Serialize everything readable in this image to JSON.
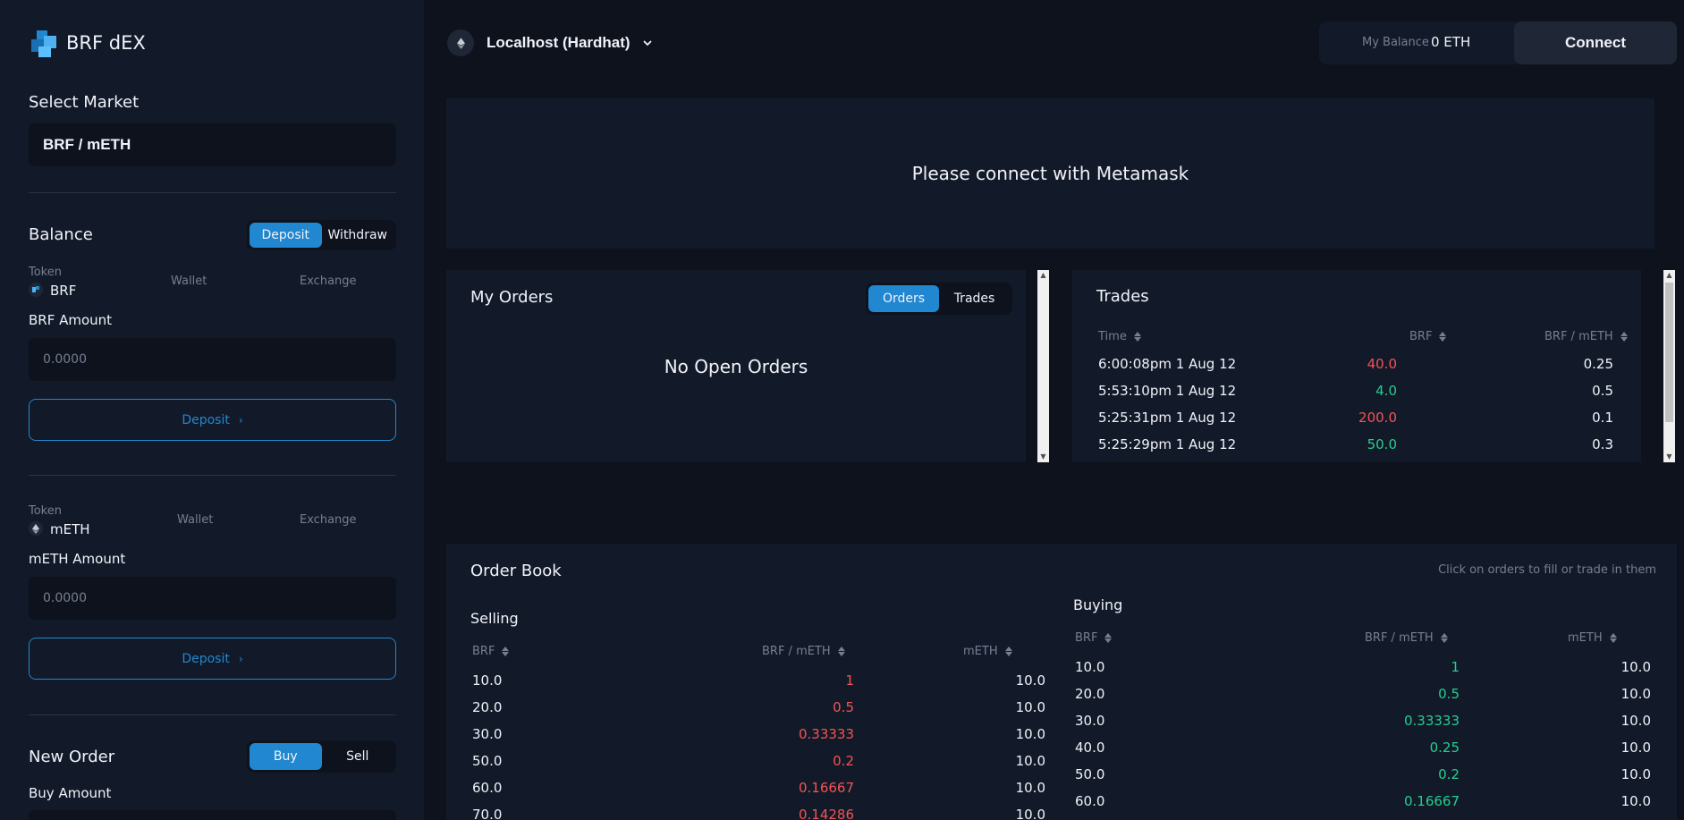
{
  "app": {
    "name": "BRF dEX"
  },
  "sidebar": {
    "select_market_label": "Select Market",
    "market_value": "BRF / mETH",
    "balance": {
      "title": "Balance",
      "tabs": [
        "Deposit",
        "Withdraw"
      ],
      "active_tab": "Deposit",
      "token1": {
        "token_label": "Token",
        "symbol": "BRF",
        "wallet_label": "Wallet",
        "exchange_label": "Exchange",
        "amount_label": "BRF Amount",
        "amount_placeholder": "0.0000",
        "button_label": "Deposit"
      },
      "token2": {
        "token_label": "Token",
        "symbol": "mETH",
        "wallet_label": "Wallet",
        "exchange_label": "Exchange",
        "amount_label": "mETH Amount",
        "amount_placeholder": "0.0000",
        "button_label": "Deposit"
      }
    },
    "new_order": {
      "title": "New Order",
      "tabs": [
        "Buy",
        "Sell"
      ],
      "active_tab": "Buy",
      "amount_label": "Buy Amount"
    }
  },
  "header": {
    "network": "Localhost (Hardhat)",
    "balance_label": "My Balance",
    "balance_value": "0 ETH",
    "connect_label": "Connect"
  },
  "banner": {
    "message": "Please connect with Metamask"
  },
  "my_orders": {
    "title": "My Orders",
    "tabs": [
      "Orders",
      "Trades"
    ],
    "active_tab": "Orders",
    "empty_message": "No Open Orders"
  },
  "trades": {
    "title": "Trades",
    "columns": [
      "Time",
      "BRF",
      "BRF / mETH"
    ],
    "rows": [
      {
        "time": "6:00:08pm 1 Aug 12",
        "amount": "40.0",
        "price": "0.25",
        "side": "sell"
      },
      {
        "time": "5:53:10pm 1 Aug 12",
        "amount": "4.0",
        "price": "0.5",
        "side": "buy"
      },
      {
        "time": "5:25:31pm 1 Aug 12",
        "amount": "200.0",
        "price": "0.1",
        "side": "sell"
      },
      {
        "time": "5:25:29pm 1 Aug 12",
        "amount": "50.0",
        "price": "0.3",
        "side": "buy"
      }
    ]
  },
  "order_book": {
    "title": "Order Book",
    "hint": "Click on orders to fill or trade in them",
    "selling": {
      "title": "Selling",
      "columns": [
        "BRF",
        "BRF / mETH",
        "mETH"
      ],
      "rows": [
        {
          "brf": "10.0",
          "price": "1",
          "meth": "10.0"
        },
        {
          "brf": "20.0",
          "price": "0.5",
          "meth": "10.0"
        },
        {
          "brf": "30.0",
          "price": "0.33333",
          "meth": "10.0"
        },
        {
          "brf": "50.0",
          "price": "0.2",
          "meth": "10.0"
        },
        {
          "brf": "60.0",
          "price": "0.16667",
          "meth": "10.0"
        },
        {
          "brf": "70.0",
          "price": "0.14286",
          "meth": "10.0"
        }
      ]
    },
    "buying": {
      "title": "Buying",
      "columns": [
        "BRF",
        "BRF / mETH",
        "mETH"
      ],
      "rows": [
        {
          "brf": "10.0",
          "price": "1",
          "meth": "10.0"
        },
        {
          "brf": "20.0",
          "price": "0.5",
          "meth": "10.0"
        },
        {
          "brf": "30.0",
          "price": "0.33333",
          "meth": "10.0"
        },
        {
          "brf": "40.0",
          "price": "0.25",
          "meth": "10.0"
        },
        {
          "brf": "50.0",
          "price": "0.2",
          "meth": "10.0"
        },
        {
          "brf": "60.0",
          "price": "0.16667",
          "meth": "10.0"
        }
      ]
    }
  },
  "colors": {
    "accent": "#2187d0",
    "sell": "#f45353",
    "buy": "#25ce8f",
    "background": "#0d121d",
    "panel": "#121a29"
  }
}
